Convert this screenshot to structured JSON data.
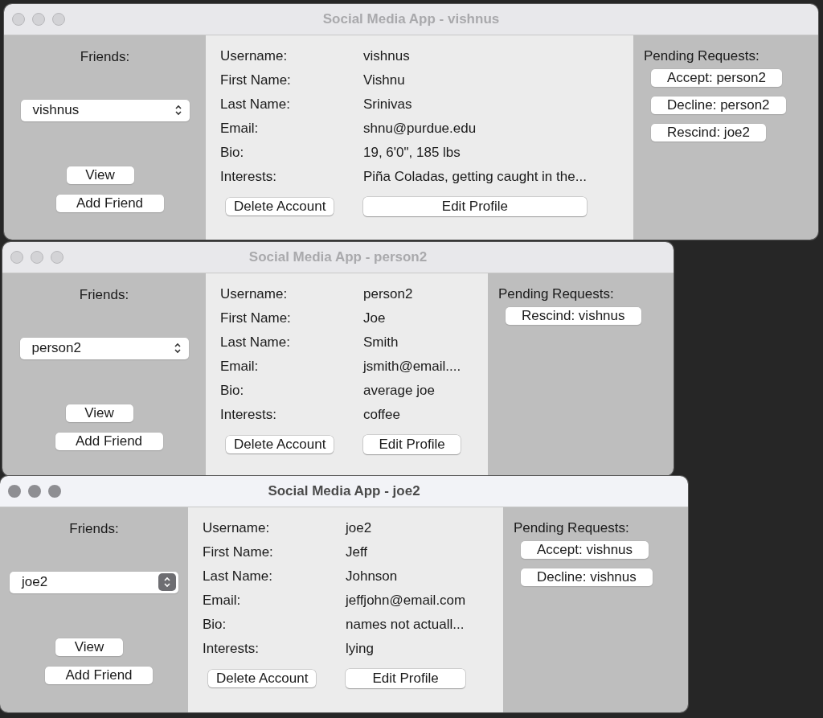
{
  "windows": [
    {
      "title": "Social Media App - vishnus",
      "active": false,
      "friends_label": "Friends:",
      "friend_select": {
        "value": "vishnus"
      },
      "view_button": "View",
      "add_friend_button": "Add Friend",
      "profile": [
        {
          "label": "Username:",
          "value": "vishnus"
        },
        {
          "label": "First Name:",
          "value": "Vishnu"
        },
        {
          "label": "Last Name:",
          "value": "Srinivas"
        },
        {
          "label": "Email:",
          "value": "shnu@purdue.edu"
        },
        {
          "label": "Bio:",
          "value": "19, 6'0\", 185 lbs"
        },
        {
          "label": "Interests:",
          "value": "Piña Coladas, getting caught in the..."
        }
      ],
      "delete_button": "Delete Account",
      "edit_button": "Edit Profile",
      "pending_label": "Pending Requests:",
      "requests": [
        "Accept: person2",
        "Decline: person2",
        "Rescind: joe2"
      ]
    },
    {
      "title": "Social Media App - person2",
      "active": false,
      "friends_label": "Friends:",
      "friend_select": {
        "value": "person2"
      },
      "view_button": "View",
      "add_friend_button": "Add Friend",
      "profile": [
        {
          "label": "Username:",
          "value": "person2"
        },
        {
          "label": "First Name:",
          "value": "Joe"
        },
        {
          "label": "Last Name:",
          "value": "Smith"
        },
        {
          "label": "Email:",
          "value": "jsmith@email...."
        },
        {
          "label": "Bio:",
          "value": "average joe"
        },
        {
          "label": "Interests:",
          "value": "coffee"
        }
      ],
      "delete_button": "Delete Account",
      "edit_button": "Edit Profile",
      "pending_label": "Pending Requests:",
      "requests": [
        "Rescind: vishnus"
      ]
    },
    {
      "title": "Social Media App - joe2",
      "active": true,
      "friends_label": "Friends:",
      "friend_select": {
        "value": "joe2"
      },
      "view_button": "View",
      "add_friend_button": "Add Friend",
      "profile": [
        {
          "label": "Username:",
          "value": "joe2"
        },
        {
          "label": "First Name:",
          "value": "Jeff"
        },
        {
          "label": "Last Name:",
          "value": "Johnson"
        },
        {
          "label": "Email:",
          "value": "jeffjohn@email.com"
        },
        {
          "label": "Bio:",
          "value": "names not actuall..."
        },
        {
          "label": "Interests:",
          "value": "lying"
        }
      ],
      "delete_button": "Delete Account",
      "edit_button": "Edit Profile",
      "pending_label": "Pending Requests:",
      "requests": [
        "Accept: vishnus",
        "Decline: vishnus"
      ]
    }
  ]
}
